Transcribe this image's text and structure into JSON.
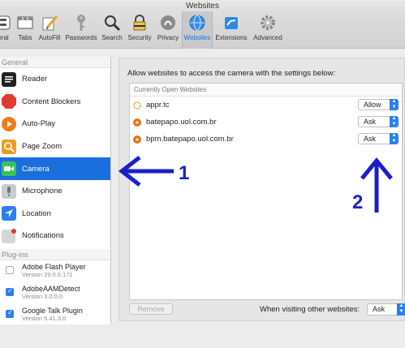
{
  "window": {
    "title": "Websites"
  },
  "toolbar": {
    "items": [
      {
        "label": "eral",
        "icon": "general-switch-icon"
      },
      {
        "label": "Tabs",
        "icon": "tabs-icon"
      },
      {
        "label": "AutoFill",
        "icon": "pencil-icon"
      },
      {
        "label": "Passwords",
        "icon": "key-icon"
      },
      {
        "label": "Search",
        "icon": "magnifier-icon"
      },
      {
        "label": "Security",
        "icon": "lock-icon"
      },
      {
        "label": "Privacy",
        "icon": "privacy-icon"
      },
      {
        "label": "Websites",
        "icon": "globe-icon",
        "active": true
      },
      {
        "label": "Extensions",
        "icon": "puzzle-icon"
      },
      {
        "label": "Advanced",
        "icon": "gear-icon"
      }
    ]
  },
  "sidebar": {
    "general_header": "General",
    "items": [
      {
        "label": "Reader",
        "icon": "reader-icon",
        "color": "#222222"
      },
      {
        "label": "Content Blockers",
        "icon": "stop-icon",
        "color": "#e23a2f"
      },
      {
        "label": "Auto-Play",
        "icon": "play-icon",
        "color": "#f07a1a"
      },
      {
        "label": "Page Zoom",
        "icon": "zoom-icon",
        "color": "#f29a1a"
      },
      {
        "label": "Camera",
        "icon": "camera-icon",
        "color": "#3ac25a",
        "selected": true
      },
      {
        "label": "Microphone",
        "icon": "microphone-icon",
        "color": "#9aa3ad"
      },
      {
        "label": "Location",
        "icon": "location-icon",
        "color": "#2c7ff0"
      },
      {
        "label": "Notifications",
        "icon": "notifications-icon",
        "color": "#b0b0b0"
      }
    ],
    "plugins_header": "Plug-ins",
    "plugins": [
      {
        "name": "Adobe Flash Player",
        "version": "Version 29.0.0.171",
        "enabled": false
      },
      {
        "name": "AdobeAAMDetect",
        "version": "Version 3.0.0.0",
        "enabled": true
      },
      {
        "name": "Google Talk Plugin",
        "version": "Version 5.41.3.0",
        "enabled": true
      }
    ]
  },
  "main": {
    "intro": "Allow websites to access the camera with the settings below:",
    "table_header": "Currently Open Websites",
    "rows": [
      {
        "site": "appr.tc",
        "value": "Allow"
      },
      {
        "site": "batepapo.uol.com.br",
        "value": "Ask"
      },
      {
        "site": "bpm.batepapo.uol.com.br",
        "value": "Ask"
      }
    ],
    "remove_label": "Remove",
    "other_label": "When visiting other websites:",
    "other_value": "Ask"
  },
  "annotations": {
    "one": "1",
    "two": "2",
    "color": "#1a1fc8"
  }
}
